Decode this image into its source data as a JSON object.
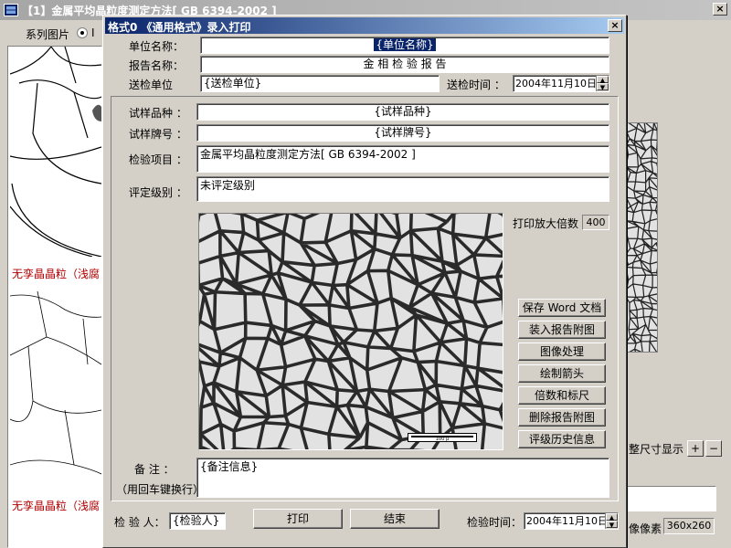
{
  "main_window": {
    "title": "【1】金属平均晶粒度测定方法[ GB 6394-2002 ]",
    "close_glyph": "×",
    "series_label": "系列图片",
    "series_radio_label": "I",
    "thumb_captions": [
      "无孪晶晶粒（浅腐",
      "无孪晶晶粒（浅腐"
    ],
    "fit_size_label": "整尺寸显示",
    "zoom_in_glyph": "+",
    "zoom_out_glyph": "−",
    "pixel_label": "像像素",
    "pixel_value": "360x260"
  },
  "dialog": {
    "title": "格式0 《通用格式》录入打印",
    "close_glyph": "×",
    "unit_name_label": "单位名称：",
    "unit_name_value": "{单位名称}",
    "report_name_label": "报告名称：",
    "report_name_value": "金 相 检 验 报 告",
    "send_unit_label": "送检单位",
    "send_unit_value": "{送检单位}",
    "send_time_label": "送检时间 ：",
    "send_time_value": "2004年11月10日",
    "sample_type_label": "试样品种 ：",
    "sample_type_value": "{试样品种}",
    "sample_grade_label": "试样牌号 ：",
    "sample_grade_value": "{试样牌号}",
    "test_item_label": "检验项目 ：",
    "test_item_value": "金属平均晶粒度测定方法[  GB 6394-2002  ]",
    "rating_label": "评定级别 ：",
    "rating_value": "未评定级别",
    "print_mag_label": "打印放大倍数",
    "print_mag_value": "400",
    "scale_bar_text": "100 μ",
    "buttons": [
      "保存 Word 文档",
      "装入报告附图",
      "图像处理",
      "绘制箭头",
      "倍数和标尺",
      "删除报告附图",
      "评级历史信息"
    ],
    "remark_label": "备   注 ：",
    "remark_hint": "（用回车键换行）",
    "remark_value": "{备注信息}",
    "inspector_label": "检 验 人：",
    "inspector_value": "{检验人}",
    "print_button": "打印",
    "end_button": "结束",
    "inspect_time_label": "检验时间：",
    "inspect_time_value": "2004年11月10日",
    "spin_up": "▲",
    "spin_down": "▼"
  }
}
